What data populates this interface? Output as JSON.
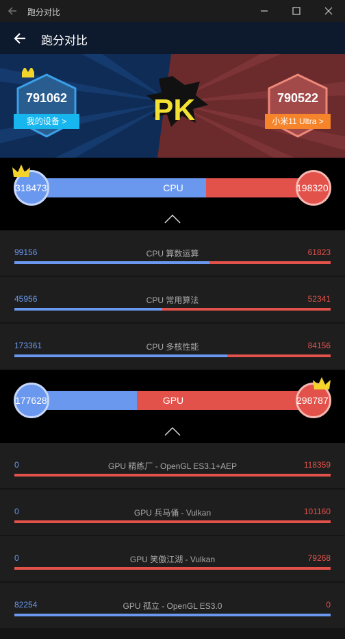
{
  "window": {
    "title": "跑分对比"
  },
  "appbar": {
    "title": "跑分对比"
  },
  "banner": {
    "left": {
      "score": "791062",
      "label": "我的设备 >"
    },
    "right": {
      "score": "790522",
      "label": "小米11 Ultra >"
    },
    "center_text": "PK"
  },
  "cpu": {
    "label": "CPU",
    "left": "318473",
    "right": "198320",
    "left_fraction": 0.616,
    "rows": [
      {
        "label": "CPU 算数运算",
        "left": "99156",
        "right": "61823",
        "left_fraction": 0.616
      },
      {
        "label": "CPU 常用算法",
        "left": "45956",
        "right": "52341",
        "left_fraction": 0.468
      },
      {
        "label": "CPU 多核性能",
        "left": "173361",
        "right": "84156",
        "left_fraction": 0.673
      }
    ]
  },
  "gpu": {
    "label": "GPU",
    "left": "177628",
    "right": "298787",
    "left_fraction": 0.373,
    "rows": [
      {
        "label": "GPU 精练厂 - OpenGL ES3.1+AEP",
        "left": "0",
        "right": "118359",
        "left_fraction": 0
      },
      {
        "label": "GPU 兵马俑 - Vulkan",
        "left": "0",
        "right": "101160",
        "left_fraction": 0
      },
      {
        "label": "GPU 笑傲江湖 - Vulkan",
        "left": "0",
        "right": "79268",
        "left_fraction": 0
      },
      {
        "label": "GPU 孤立 - OpenGL ES3.0",
        "left": "82254",
        "right": "0",
        "left_fraction": 1
      }
    ]
  },
  "colors": {
    "mine": "#6b98ef",
    "other": "#e3524a"
  }
}
